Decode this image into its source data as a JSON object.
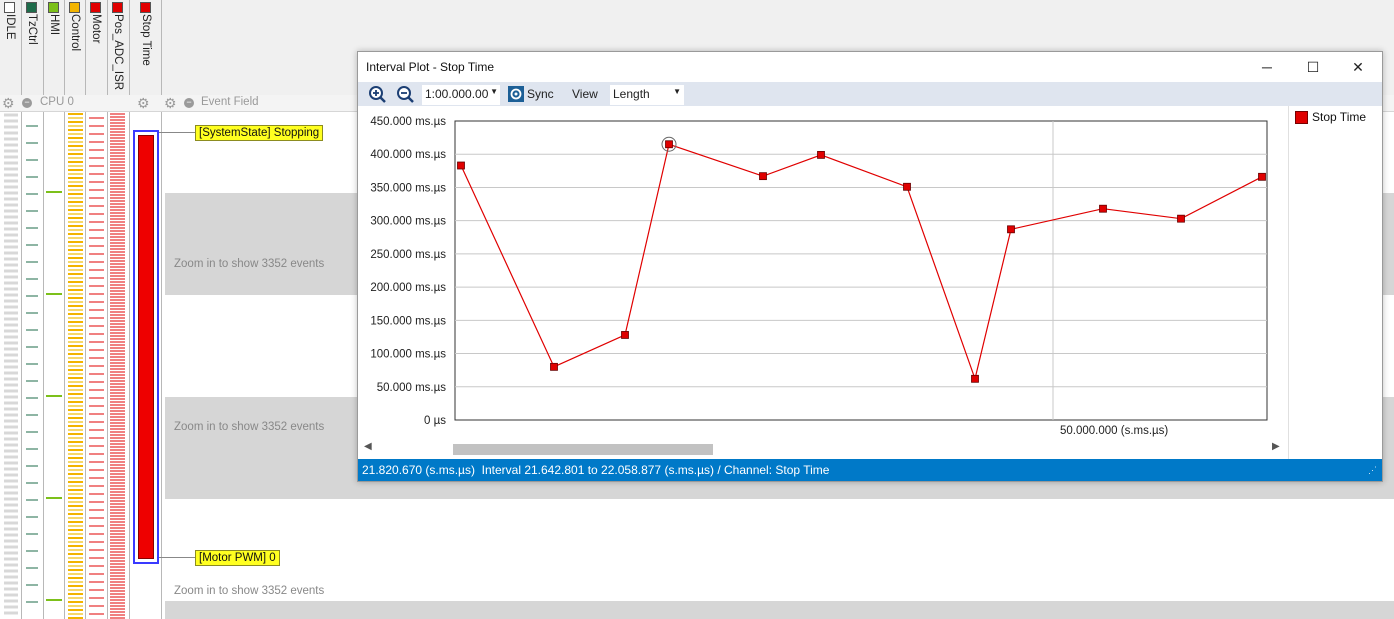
{
  "channels": [
    {
      "label": "IDLE",
      "color": "#ffffff"
    },
    {
      "label": "TzCtrl",
      "color": "#1e6b4a"
    },
    {
      "label": "HMI",
      "color": "#7cc01a"
    },
    {
      "label": "Control",
      "color": "#f2b400"
    },
    {
      "label": "Motor",
      "color": "#e00000"
    },
    {
      "label": "Pos_ADC_ISR",
      "color": "#e00000"
    },
    {
      "label": "Stop Time",
      "color": "#e00000"
    }
  ],
  "cpu_label": "CPU 0",
  "event_field_label": "Event Field",
  "zoom_texts": [
    "Zoom in to show 3352 events",
    "Zoom in to show 3352 events",
    "Zoom in to show 3352 events"
  ],
  "tags": {
    "system_state": "[SystemState] Stopping",
    "motor_pwm": "[Motor PWM] 0"
  },
  "plot_window": {
    "title": "Interval Plot - Stop Time",
    "buttons": {
      "minimize": "─",
      "maximize": "☐",
      "close": "✕"
    },
    "toolbar": {
      "zoom_in_icon": "zoom-in-icon",
      "zoom_out_icon": "zoom-out-icon",
      "time_value": "1:00.000.00",
      "sync_label": "Sync",
      "view_label": "View",
      "length_value": "Length"
    },
    "legend": [
      {
        "label": "Stop Time",
        "color": "#e00000"
      }
    ],
    "status_text": "21.820.670 (s.ms.µs)  Interval 21.642.801 to 22.058.877 (s.ms.µs) / Channel: Stop Time",
    "x_marker_label": "50.000.000 (s.ms.µs)"
  },
  "chart_data": {
    "type": "line",
    "ylim": [
      0,
      450
    ],
    "yticks": [
      {
        "v": 450,
        "label": "450.000 ms.µs"
      },
      {
        "v": 400,
        "label": "400.000 ms.µs"
      },
      {
        "v": 350,
        "label": "350.000 ms.µs"
      },
      {
        "v": 300,
        "label": "300.000 ms.µs"
      },
      {
        "v": 250,
        "label": "250.000 ms.µs"
      },
      {
        "v": 200,
        "label": "200.000 ms.µs"
      },
      {
        "v": 150,
        "label": "150.000 ms.µs"
      },
      {
        "v": 100,
        "label": "100.000 ms.µs"
      },
      {
        "v": 50,
        "label": "50.000 ms.µs"
      },
      {
        "v": 0,
        "label": "0 µs"
      }
    ],
    "series": [
      {
        "name": "Stop Time",
        "color": "#e00000",
        "values": [
          383,
          80,
          128,
          415,
          367,
          399,
          351,
          62,
          287,
          318,
          303,
          366
        ]
      }
    ]
  }
}
